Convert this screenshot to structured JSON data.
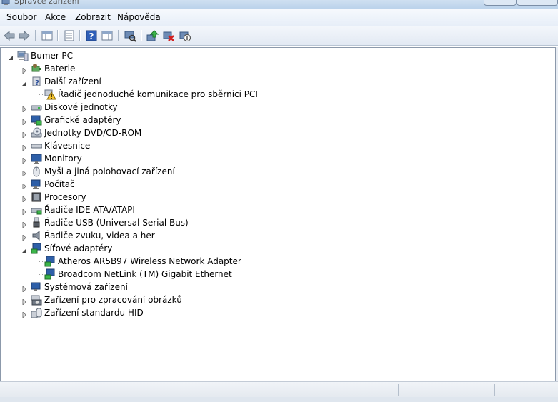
{
  "window": {
    "title": "Správce zařízení"
  },
  "menu": [
    "Soubor",
    "Akce",
    "Zobrazit",
    "Nápověda"
  ],
  "toolbar": [
    {
      "name": "back-button",
      "icon": "back-arrow-icon"
    },
    {
      "name": "forward-button",
      "icon": "forward-arrow-icon"
    },
    {
      "name": "show-hide-console-tree-button",
      "icon": "console-tree-icon"
    },
    {
      "name": "properties-button",
      "icon": "properties-icon"
    },
    {
      "name": "help-button",
      "icon": "help-icon"
    },
    {
      "name": "action-pane-button",
      "icon": "action-pane-icon"
    },
    {
      "name": "scan-hardware-button",
      "icon": "scan-hardware-icon"
    },
    {
      "name": "update-driver-button",
      "icon": "update-driver-icon"
    },
    {
      "name": "uninstall-button",
      "icon": "uninstall-icon"
    },
    {
      "name": "disable-button",
      "icon": "disable-icon"
    }
  ],
  "tree": {
    "root": {
      "label": "Bumer-PC",
      "icon": "computer-icon",
      "expanded": true
    },
    "categories": [
      {
        "label": "Baterie",
        "icon": "battery-icon",
        "expanded": false
      },
      {
        "label": "Další zařízení",
        "icon": "unknown-device-icon",
        "expanded": true,
        "children": [
          {
            "label": "Řadič jednoduché komunikace pro sběrnici PCI",
            "icon": "warning-device-icon"
          }
        ]
      },
      {
        "label": "Diskové jednotky",
        "icon": "disk-drive-icon",
        "expanded": false
      },
      {
        "label": "Grafické adaptéry",
        "icon": "display-adapter-icon",
        "expanded": false
      },
      {
        "label": "Jednotky DVD/CD-ROM",
        "icon": "dvd-drive-icon",
        "expanded": false
      },
      {
        "label": "Klávesnice",
        "icon": "keyboard-icon",
        "expanded": false
      },
      {
        "label": "Monitory",
        "icon": "monitor-icon",
        "expanded": false
      },
      {
        "label": "Myši a jiná polohovací zařízení",
        "icon": "mouse-icon",
        "expanded": false
      },
      {
        "label": "Počítač",
        "icon": "computer-icon",
        "expanded": false
      },
      {
        "label": "Procesory",
        "icon": "processor-icon",
        "expanded": false
      },
      {
        "label": "Řadiče IDE ATA/ATAPI",
        "icon": "ide-controller-icon",
        "expanded": false
      },
      {
        "label": "Řadiče USB (Universal Serial Bus)",
        "icon": "usb-icon",
        "expanded": false
      },
      {
        "label": "Řadiče zvuku, videa a her",
        "icon": "speaker-icon",
        "expanded": false
      },
      {
        "label": "Síťové adaptéry",
        "icon": "network-adapter-icon",
        "expanded": true,
        "children": [
          {
            "label": "Atheros AR5B97 Wireless Network Adapter",
            "icon": "network-adapter-icon"
          },
          {
            "label": "Broadcom NetLink (TM) Gigabit Ethernet",
            "icon": "network-adapter-icon"
          }
        ]
      },
      {
        "label": "Systémová zařízení",
        "icon": "system-device-icon",
        "expanded": false
      },
      {
        "label": "Zařízení pro zpracování obrázků",
        "icon": "camera-icon",
        "expanded": false
      },
      {
        "label": "Zařízení standardu HID",
        "icon": "hid-icon",
        "expanded": false
      }
    ]
  }
}
